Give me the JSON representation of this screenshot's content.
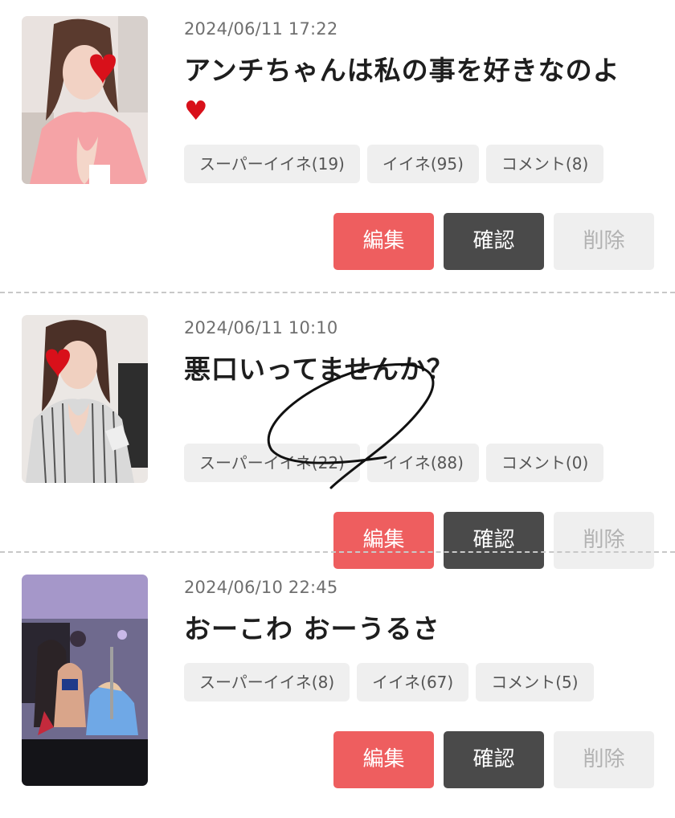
{
  "posts": [
    {
      "date": "2024/06/11 17:22",
      "title": "アンチちゃんは私の事を好きなのよ",
      "title_heart": "♥",
      "stats": {
        "super_like": "スーパーイイネ(19)",
        "like": "イイネ(95)",
        "comment": "コメント(8)"
      },
      "actions": {
        "edit": "編集",
        "confirm": "確認",
        "delete": "削除"
      }
    },
    {
      "date": "2024/06/11 10:10",
      "title": "悪口いってませんか？",
      "title_heart": "",
      "stats": {
        "super_like": "スーパーイイネ(22)",
        "like": "イイネ(88)",
        "comment": "コメント(0)"
      },
      "actions": {
        "edit": "編集",
        "confirm": "確認",
        "delete": "削除"
      }
    },
    {
      "date": "2024/06/10 22:45",
      "title": "おーこわ おーうるさ",
      "title_heart": "",
      "stats": {
        "super_like": "スーパーイイネ(8)",
        "like": "イイネ(67)",
        "comment": "コメント(5)"
      },
      "actions": {
        "edit": "編集",
        "confirm": "確認",
        "delete": "削除"
      }
    }
  ],
  "colors": {
    "edit_button": "#ee5e5f",
    "confirm_button": "#4a4a4a",
    "delete_button": "#efefef",
    "chip_background": "#efefef",
    "heart": "#d8101a"
  }
}
